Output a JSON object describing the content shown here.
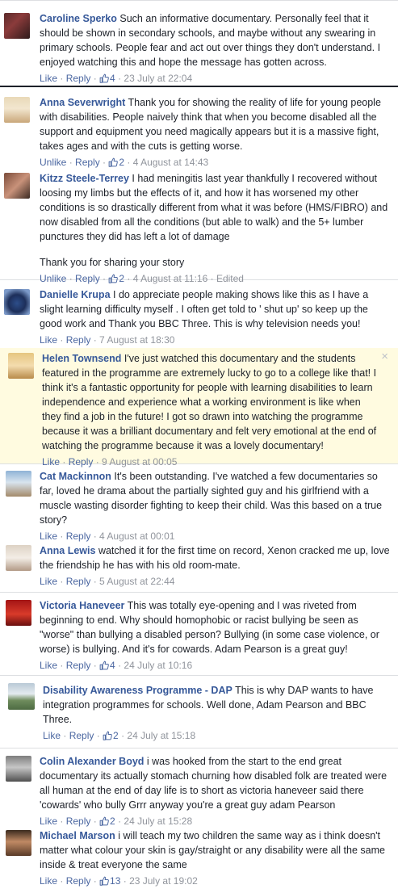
{
  "comments": [
    {
      "author": "Caroline Sperko",
      "text": "Such an informative documentary. Personally feel that it should be shown in secondary schools, and maybe without any swearing in primary schools. People fear and act out over things they don't understand. I enjoyed watching this and hope the message has gotten across.",
      "like_label": "Like",
      "reply_label": "Reply",
      "likes": "4",
      "date": "23 July at 22:04",
      "edited": ""
    },
    {
      "author": "Anna Severwright",
      "text": "Thank you for showing the reality of life for young people with disabilities. People naively think that when you become disabled all the support and equipment you need magically appears but it is a massive fight, takes ages and with the cuts is getting worse.",
      "like_label": "Unlike",
      "reply_label": "Reply",
      "likes": "2",
      "date": "4 August at 14:43",
      "edited": ""
    },
    {
      "author": "Kitzz Steele-Terrey",
      "text": "I had meningitis last year thankfully I recovered without loosing my limbs but the effects of it, and how it has worsened my other conditions is so drastically different from what it was before (HMS/FIBRO) and now disabled from all the conditions (but able to walk) and the 5+ lumber punctures they did has left a lot of damage",
      "text2": "Thank you for sharing your story",
      "like_label": "Unlike",
      "reply_label": "Reply",
      "likes": "2",
      "date": "4 August at 11:16",
      "edited": "Edited"
    },
    {
      "author": "Danielle Krupa",
      "text": "I do appreciate people making shows like this as I have a slight learning difficulty myself . I often get told to ' shut up' so keep up the good work and Thank you BBC Three. This is why television needs you!",
      "like_label": "Like",
      "reply_label": "Reply",
      "likes": "",
      "date": "7 August at 18:30",
      "edited": ""
    },
    {
      "author": "Helen Townsend",
      "text": "I've just watched this documentary and the students featured in the programme are extremely lucky to go to a college like that! I think it's a fantastic opportunity for people with learning disabilities to learn independence and experience what a working environment is like when they find a job in the future! I got so drawn into watching the programme because it was a brilliant documentary and felt very emotional at the end of watching the programme because it was a lovely documentary!",
      "like_label": "Like",
      "reply_label": "Reply",
      "likes": "",
      "date": "9 August at 00:05",
      "edited": "",
      "close": "×"
    },
    {
      "author": "Cat Mackinnon",
      "text": "It's been outstanding. I've watched a few documentaries so far, loved he drama about the partially sighted guy and his girlfriend with a muscle wasting disorder fighting to keep their child. Was this based on a true story?",
      "like_label": "Like",
      "reply_label": "Reply",
      "likes": "",
      "date": "4 August at 00:01",
      "edited": ""
    },
    {
      "author": "Anna Lewis",
      "text": "watched it for the first time on record, Xenon cracked me up, love the friendship he has with his old room-mate.",
      "like_label": "Like",
      "reply_label": "Reply",
      "likes": "",
      "date": "5 August at 22:44",
      "edited": ""
    },
    {
      "author": "Victoria Haneveer",
      "text": "This was totally eye-opening and I was riveted from beginning to end. Why should homophobic or racist bullying be seen as \"worse\" than bullying a disabled person? Bullying (in some case violence, or worse) is bullying. And it's for cowards. Adam Pearson is a great guy!",
      "like_label": "Like",
      "reply_label": "Reply",
      "likes": "4",
      "date": "24 July at 10:16",
      "edited": ""
    },
    {
      "author": "Disability Awareness Programme - DAP",
      "text": "This is why DAP wants to have integration programmes for schools. Well done, Adam Pearson and BBC Three.",
      "like_label": "Like",
      "reply_label": "Reply",
      "likes": "2",
      "date": "24 July at 15:18",
      "edited": ""
    },
    {
      "author": "Colin Alexander Boyd",
      "text": "i was hooked from the start to the end great documentary its actually stomach churning how disabled folk are treated were all human at the end of day life is to short as victoria haneveer said there 'cowards' who bully Grrr anyway you're a great guy adam Pearson",
      "like_label": "Like",
      "reply_label": "Reply",
      "likes": "2",
      "date": "24 July at 15:28",
      "edited": ""
    },
    {
      "author": "Michael Marson",
      "text": "i will teach my two children the same way as i think doesn't matter what colour your skin is gay/straight or any disability were all the same inside & treat everyone the same",
      "like_label": "Like",
      "reply_label": "Reply",
      "likes": "13",
      "date": "23 July at 19:02",
      "edited": ""
    }
  ]
}
